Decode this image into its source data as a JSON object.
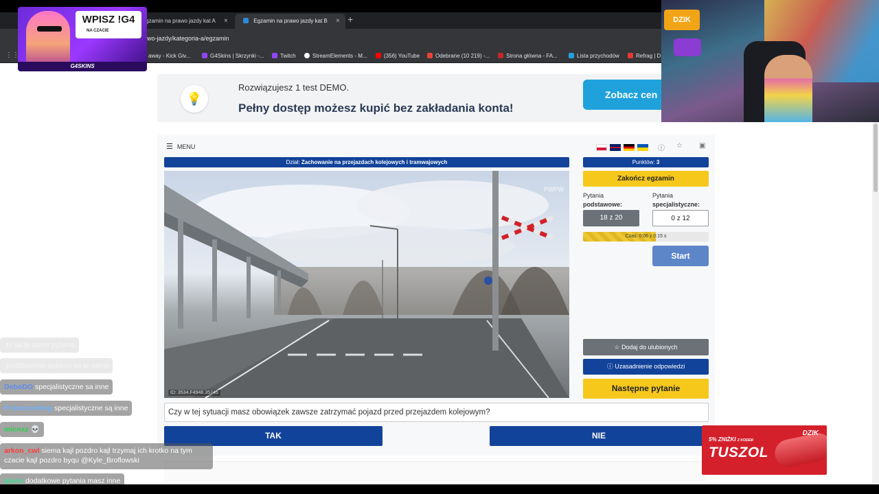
{
  "browser": {
    "tabs": [
      {
        "label": "gzamin na prawo jazdy kat A"
      },
      {
        "label": "Egzamin na prawo jazdy kat B"
      }
    ],
    "url": "wo-jazdy/kategoria-a/egzamin",
    "bookmarks": [
      {
        "label": "away - Kick Giv..."
      },
      {
        "label": "G4Skins | Skrzynki -..."
      },
      {
        "label": "Twitch"
      },
      {
        "label": "StreamElements - M..."
      },
      {
        "label": "(356) YouTube"
      },
      {
        "label": "Odebrane (10 219) -..."
      },
      {
        "label": "Strona główna - FA..."
      },
      {
        "label": "Lista przychodów"
      },
      {
        "label": "Refrag | D"
      }
    ]
  },
  "overlay": {
    "promo_title": "WPISZ !G4",
    "promo_sub": "NA CZACIE",
    "promo_brand": "G4SKINS",
    "webcam_logo": "DZIK"
  },
  "banner": {
    "line1": "Rozwiązujesz 1 test DEMO.",
    "line2": "Pełny dostęp możesz kupić bez zakładania konta!",
    "cta": "Zobacz cen"
  },
  "exam": {
    "menu_label": "MENU",
    "dzial_prefix": "Dział:",
    "dzial_name": "Zachowanie na przejazdach kolejowych i tramwajowych",
    "points_label": "Punktów:",
    "points_value": "3",
    "finish_button": "Zakończ egzamin",
    "basic_label_1": "Pytania",
    "basic_label_2": "podstawowe:",
    "spec_label_1": "Pytania",
    "spec_label_2": "specjalistyczne:",
    "basic_count": "18 z 20",
    "spec_count": "0 z 12",
    "time_text": "Czas: 0:06 z 0:15 s",
    "time_fraction": 0.58,
    "start_button": "Start",
    "favorite_button": "Dodaj do ulubionych",
    "explanation_button": "Uzasadnienie odpowiedzi",
    "next_button": "Następne pytanie",
    "image_watermark": "ID: 3534.F4948.35745",
    "image_brand": "PWPW",
    "question": "Czy w tej sytuacji masz obowiązek zawsze zatrzymać pojazd przed przejazdem kolejowym?",
    "answer_yes": "TAK",
    "answer_no": "NIE"
  },
  "chat": [
    {
      "user": "",
      "text": "to sa te same pytania",
      "faded": true
    },
    {
      "user": "",
      "text": "podstawowe pytania sa te same",
      "faded": true
    },
    {
      "user": "DeboDO",
      "text": "specjalistyczne sa inne",
      "faded": false,
      "color": "#5b8df0"
    },
    {
      "user": "Primocooking",
      "text": "specjalistyczne są inne",
      "faded": false,
      "color": "#6fb0ff"
    },
    {
      "user": "micnxz",
      "text": "💀",
      "faded": false,
      "color": "#2fd14a"
    },
    {
      "user": "arkon_cwl",
      "text": "siema kajl pozdro kajl trzymaj ich krotko na tym czacie kajl pozdro byqu @Kyle_Broflowski",
      "faded": false,
      "color": "#ff3b3b"
    },
    {
      "user": "qison",
      "text": "dodatkowe pytania masz inne",
      "faded": false,
      "color": "#38e08f"
    }
  ],
  "ad": {
    "promo": "5% ZNIŻKI",
    "promo_small": "Z KODEM",
    "title": "TUSZOL",
    "brand": "DZIK"
  },
  "colors": {
    "primary_blue": "#12439a",
    "accent_yellow": "#f6c81c",
    "banner_cta": "#1fa2dc"
  }
}
